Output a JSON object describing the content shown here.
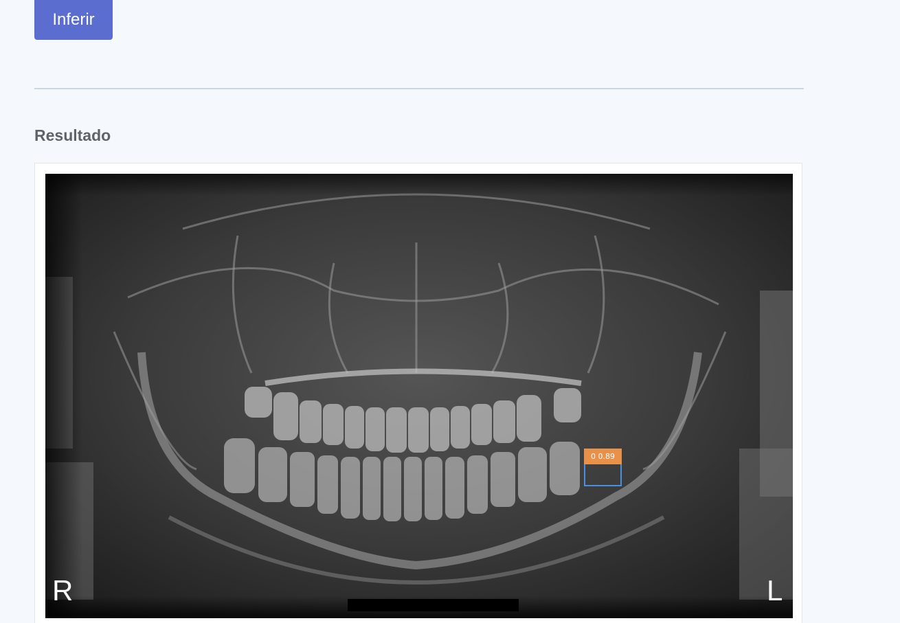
{
  "toolbar": {
    "infer_label": "Inferir"
  },
  "result": {
    "title": "Resultado",
    "image_alt": "panoramic dental x-ray",
    "marker_right": "R",
    "marker_left": "L",
    "detections": [
      {
        "label": "0 0.89",
        "box_color": "#4a90e2",
        "label_color": "#e8914a"
      }
    ]
  },
  "colors": {
    "accent": "#5b6ecf",
    "background": "#f5f8fc",
    "divider": "#c9d6e3"
  }
}
